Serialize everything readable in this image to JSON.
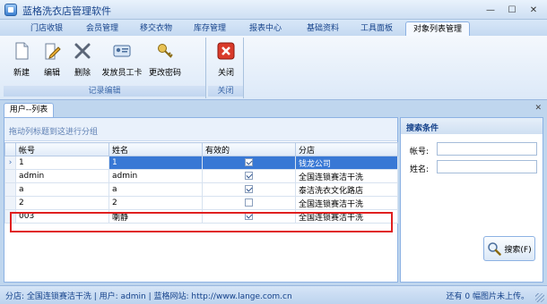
{
  "window": {
    "title": "蓝格洗衣店管理软件"
  },
  "tabs": [
    {
      "label": "门店收银",
      "active": false
    },
    {
      "label": "会员管理",
      "active": false
    },
    {
      "label": "移交衣物",
      "active": false
    },
    {
      "label": "库存管理",
      "active": false
    },
    {
      "label": "报表中心",
      "active": false
    },
    {
      "label": "基础资料",
      "active": false
    },
    {
      "label": "工具面板",
      "active": false
    },
    {
      "label": "对象列表管理",
      "active": true
    }
  ],
  "ribbon": {
    "groups": [
      {
        "label": "记录编辑",
        "buttons": [
          {
            "label": "新建",
            "icon": "new-document-icon"
          },
          {
            "label": "编辑",
            "icon": "edit-pencil-icon"
          },
          {
            "label": "删除",
            "icon": "delete-x-icon"
          },
          {
            "label": "发放员工卡",
            "icon": "id-card-icon"
          },
          {
            "label": "更改密码",
            "icon": "key-icon"
          }
        ]
      },
      {
        "label": "关闭",
        "buttons": [
          {
            "label": "关闭",
            "icon": "close-red-icon"
          }
        ]
      }
    ]
  },
  "doc_tab": {
    "label": "用户--列表"
  },
  "grid": {
    "group_hint": "拖动列标题到这进行分组",
    "columns": [
      "帐号",
      "姓名",
      "有效的",
      "分店"
    ],
    "rows": [
      {
        "account": "1",
        "name": "1",
        "valid": true,
        "store": "钱龙公司",
        "selected": true
      },
      {
        "account": "admin",
        "name": "admin",
        "valid": true,
        "store": "全国连锁赛洁干洗"
      },
      {
        "account": "a",
        "name": "a",
        "valid": true,
        "store": "泰洁洗衣文化路店"
      },
      {
        "account": "2",
        "name": "2",
        "valid": false,
        "store": "全国连锁赛洁干洗"
      },
      {
        "account": "003",
        "name": "喇静",
        "valid": true,
        "store": "全国连锁赛洁干洗",
        "highlighted": true
      }
    ]
  },
  "search": {
    "title": "搜索条件",
    "account_label": "帐号:",
    "name_label": "姓名:",
    "account_value": "",
    "name_value": "",
    "button_label": "搜索(F)"
  },
  "status": {
    "left": "分店: 全国连锁赛洁干洗 | 用户: admin | 蓝格网站: http://www.lange.com.cn",
    "right": "还有 0 幅图片未上传。"
  },
  "colors": {
    "accent": "#15428b",
    "selection": "#3878d5",
    "highlight_box": "#e02020"
  }
}
